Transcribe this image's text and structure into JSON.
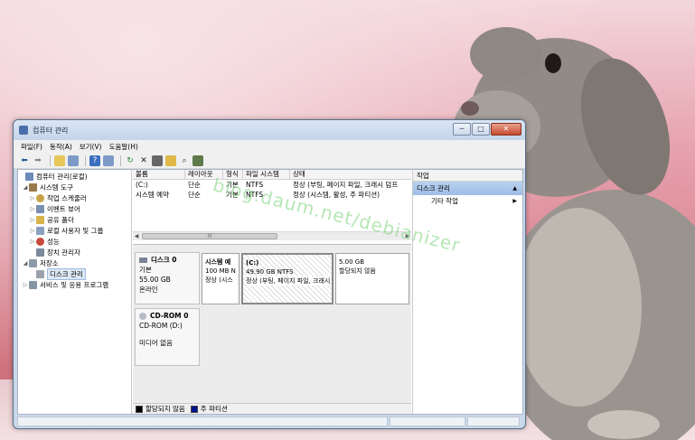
{
  "window": {
    "title": "컴퓨터 관리",
    "min_label": "─",
    "max_label": "□",
    "close_label": "✕"
  },
  "menu": [
    "파일(F)",
    "동작(A)",
    "보기(V)",
    "도움말(H)"
  ],
  "toolbar_icons": [
    "back-arrow-icon",
    "forward-arrow-icon",
    "up-folder-icon",
    "console-tree-icon",
    "help-icon",
    "properties-icon",
    "refresh-icon",
    "delete-icon",
    "properties-sheet-icon",
    "open-folder-icon",
    "search-icon",
    "zoom-icon"
  ],
  "tree": {
    "root": "컴퓨터 관리(로컬)",
    "system_tools": "시스템 도구",
    "task_scheduler": "작업 스케줄러",
    "event_viewer": "이벤트 뷰어",
    "shared_folders": "공유 폴더",
    "local_users": "로컬 사용자 및 그룹",
    "performance": "성능",
    "device_manager": "장치 관리자",
    "storage": "저장소",
    "disk_management": "디스크 관리",
    "services": "서비스 및 응용 프로그램"
  },
  "volume_table": {
    "headers": [
      "볼륨",
      "레이아웃",
      "형식",
      "파일 시스템",
      "상태"
    ],
    "rows": [
      [
        "(C:)",
        "단순",
        "기본",
        "NTFS",
        "정상 (부팅, 페이지 파일, 크래시 덤프"
      ],
      [
        "시스템 예약",
        "단순",
        "기본",
        "NTFS",
        "정상 (시스템, 활성, 주 파티션)"
      ]
    ]
  },
  "scroll_label": "III",
  "disk0": {
    "name": "디스크 0",
    "type": "기본",
    "size": "55.00 GB",
    "status": "온라인",
    "partitions": [
      {
        "name": "시스템 예",
        "size": "100 MB N",
        "status": "정상 (시스"
      },
      {
        "name": "(C:)",
        "size": "49.90 GB NTFS",
        "status": "정상 (부팅, 페이지 파일, 크래시 덤프, 주 파티션)"
      },
      {
        "name": "",
        "size": "5.00 GB",
        "status": "할당되지 않음"
      }
    ]
  },
  "cdrom": {
    "name": "CD-ROM 0",
    "drive": "CD-ROM (D:)",
    "media": "미디어 없음"
  },
  "legend": {
    "unallocated": "할당되지 않음",
    "primary": "주 파티션"
  },
  "actions": {
    "header": "작업",
    "section": "디스크 관리",
    "more": "기타 작업"
  },
  "watermark": "blog.daum.net/debianizer",
  "colors": {
    "partition_primary": "#00148f",
    "partition_unallocated": "#000000",
    "selected_section": "#9dbde5"
  }
}
